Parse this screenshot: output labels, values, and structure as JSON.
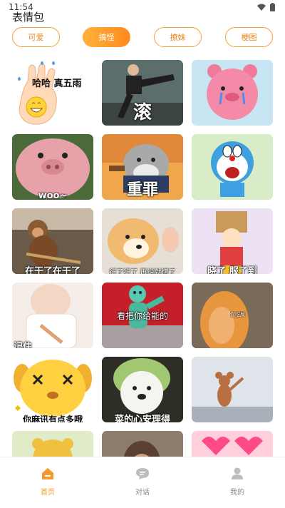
{
  "status": {
    "time": "11:54"
  },
  "app": {
    "title": "表情包"
  },
  "tabs": [
    {
      "label": "可爱",
      "active": false
    },
    {
      "label": "搞怪",
      "active": true
    },
    {
      "label": "撩妹",
      "active": false
    },
    {
      "label": "梗图",
      "active": false
    }
  ],
  "tiles": [
    {
      "caption": "哈哈 真五雨"
    },
    {
      "caption": "滚"
    },
    {
      "caption": ""
    },
    {
      "caption": "woo~"
    },
    {
      "caption": "重罪"
    },
    {
      "caption": ""
    },
    {
      "caption": "在干了在干了"
    },
    {
      "caption": "行了行了 再说就愣了"
    },
    {
      "caption": "晓了 服了到"
    },
    {
      "caption": "记住"
    },
    {
      "caption": "看把你给能的"
    },
    {
      "caption": "你吃屎"
    },
    {
      "caption": "你麻讯有点多哦"
    },
    {
      "caption": "菜的心安理得"
    },
    {
      "caption": ""
    },
    {
      "caption": ""
    },
    {
      "caption": ""
    },
    {
      "caption": ""
    }
  ],
  "nav": {
    "home": "首页",
    "chat": "对话",
    "mine": "我的"
  },
  "colors": {
    "accent": "#f29a2e",
    "tab_border": "#f2a13a"
  }
}
